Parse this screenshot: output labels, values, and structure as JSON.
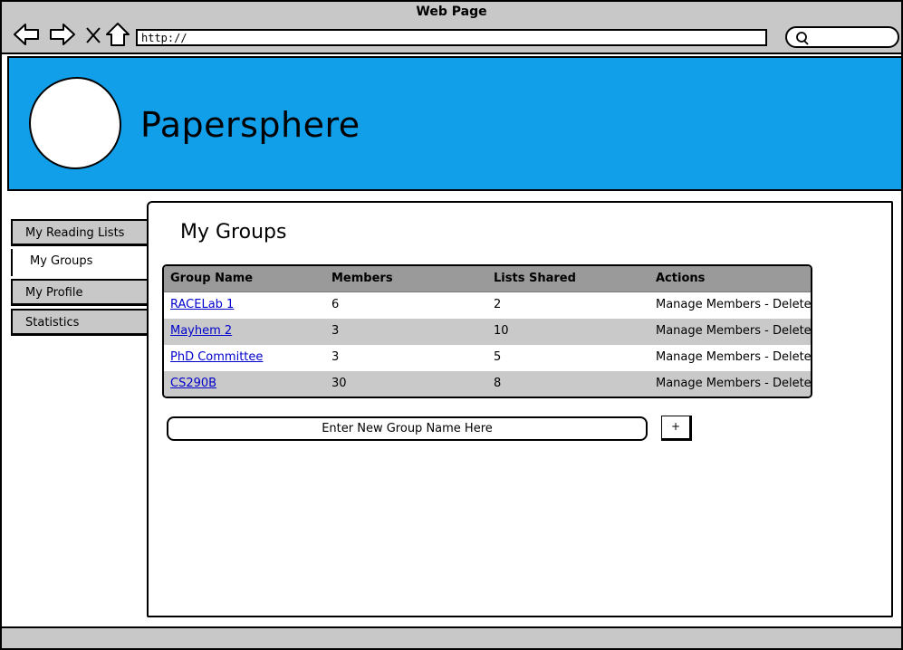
{
  "window": {
    "title": "Web Page"
  },
  "browser": {
    "url": "http://",
    "nav": [
      "back-arrow-icon",
      "forward-arrow-icon",
      "close-icon",
      "home-icon"
    ],
    "search_icon": "search-icon"
  },
  "header": {
    "app_name": "Papersphere",
    "background_color": "#129fe9"
  },
  "sidebar": {
    "items": [
      {
        "label": "My Reading Lists",
        "active": false
      },
      {
        "label": "My Groups",
        "active": true
      },
      {
        "label": "My Profile",
        "active": false
      },
      {
        "label": "Statistics",
        "active": false
      }
    ]
  },
  "main": {
    "heading": "My Groups",
    "table": {
      "columns": [
        "Group Name",
        "Members",
        "Lists Shared",
        "Actions"
      ],
      "rows": [
        {
          "name": "RACELab 1",
          "members": "6",
          "lists_shared": "2",
          "actions": "Manage Members - Delete"
        },
        {
          "name": "Mayhem 2",
          "members": "3",
          "lists_shared": "10",
          "actions": "Manage Members - Delete"
        },
        {
          "name": "PhD Committee",
          "members": "3",
          "lists_shared": "5",
          "actions": "Manage Members - Delete"
        },
        {
          "name": "CS290B",
          "members": "30",
          "lists_shared": "8",
          "actions": "Manage Members - Delete"
        }
      ]
    },
    "new_group": {
      "placeholder": "Enter New Group Name Here",
      "add_label": "+"
    }
  }
}
